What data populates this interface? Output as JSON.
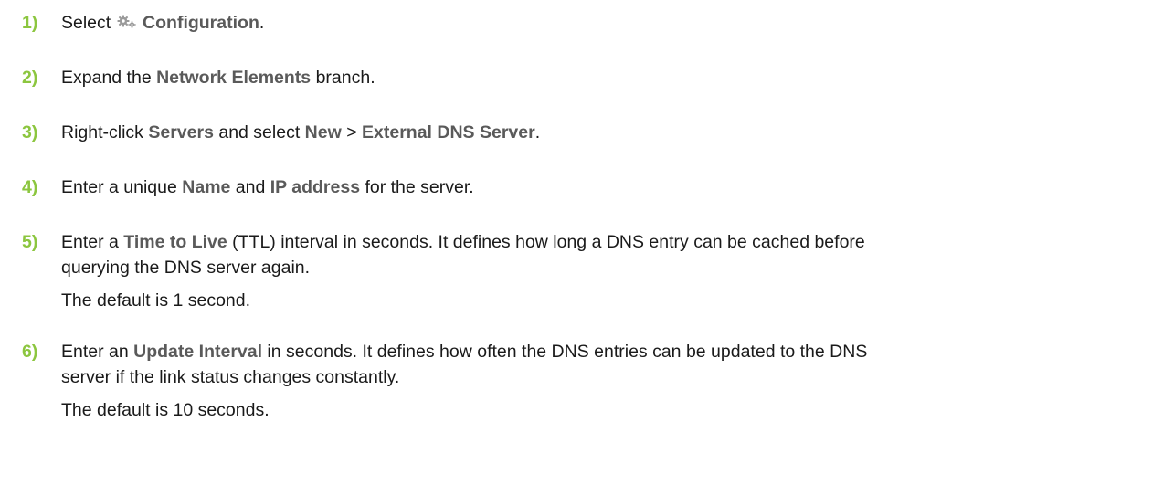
{
  "steps": [
    {
      "num": "1)",
      "parts": [
        "Select ",
        "Configuration",
        "."
      ]
    },
    {
      "num": "2)",
      "parts": [
        "Expand the ",
        "Network Elements",
        " branch."
      ]
    },
    {
      "num": "3)",
      "parts": [
        "Right-click ",
        "Servers",
        " and select ",
        "New",
        " > ",
        "External DNS Server",
        "."
      ]
    },
    {
      "num": "4)",
      "parts": [
        "Enter a unique ",
        "Name",
        " and ",
        "IP address",
        " for the server."
      ]
    },
    {
      "num": "5)",
      "line1": [
        "Enter a ",
        "Time to Live",
        " (TTL) interval in seconds. It defines how long a DNS entry can be cached before"
      ],
      "line2": "querying the DNS server again.",
      "note": "The default is 1 second."
    },
    {
      "num": "6)",
      "line1": [
        "Enter an ",
        "Update Interval",
        " in seconds. It defines how often the DNS entries can be updated to the DNS"
      ],
      "line2": "server if the link status changes constantly.",
      "note": "The default is 10 seconds."
    }
  ],
  "icons": {
    "configuration": "gears-icon"
  },
  "colors": {
    "step_number": "#8cc63f",
    "ui_term": "#5a5a5a",
    "text": "#1a1a1a",
    "icon": "#9a9a9a"
  }
}
